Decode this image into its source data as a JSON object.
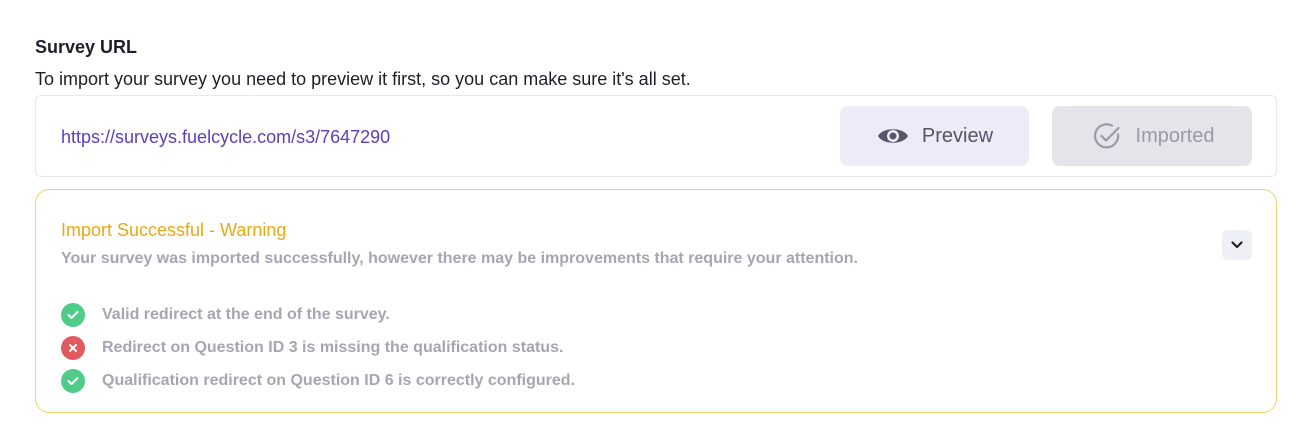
{
  "survey": {
    "title": "Survey URL",
    "description": "To import your survey you need to preview it first, so you can make sure it's all set.",
    "url": "https://surveys.fuelcycle.com/s3/7647290"
  },
  "buttons": {
    "preview_label": "Preview",
    "preview_icon": "eye-icon",
    "imported_label": "Imported",
    "imported_icon": "check-circle-icon"
  },
  "result": {
    "title": "Import Successful - Warning",
    "description": "Your survey was imported successfully, however there may be improvements that require your attention.",
    "checks": [
      {
        "status": "ok",
        "text": "Valid redirect at the end of the survey."
      },
      {
        "status": "error",
        "text": "Redirect on Question ID 3 is missing the qualification status."
      },
      {
        "status": "ok",
        "text": "Qualification redirect on Question ID 6 is correctly configured."
      }
    ]
  },
  "colors": {
    "accent": "#5a3fc0",
    "warning": "#eba812",
    "success": "#4fcb8a",
    "error": "#e05a5e"
  }
}
